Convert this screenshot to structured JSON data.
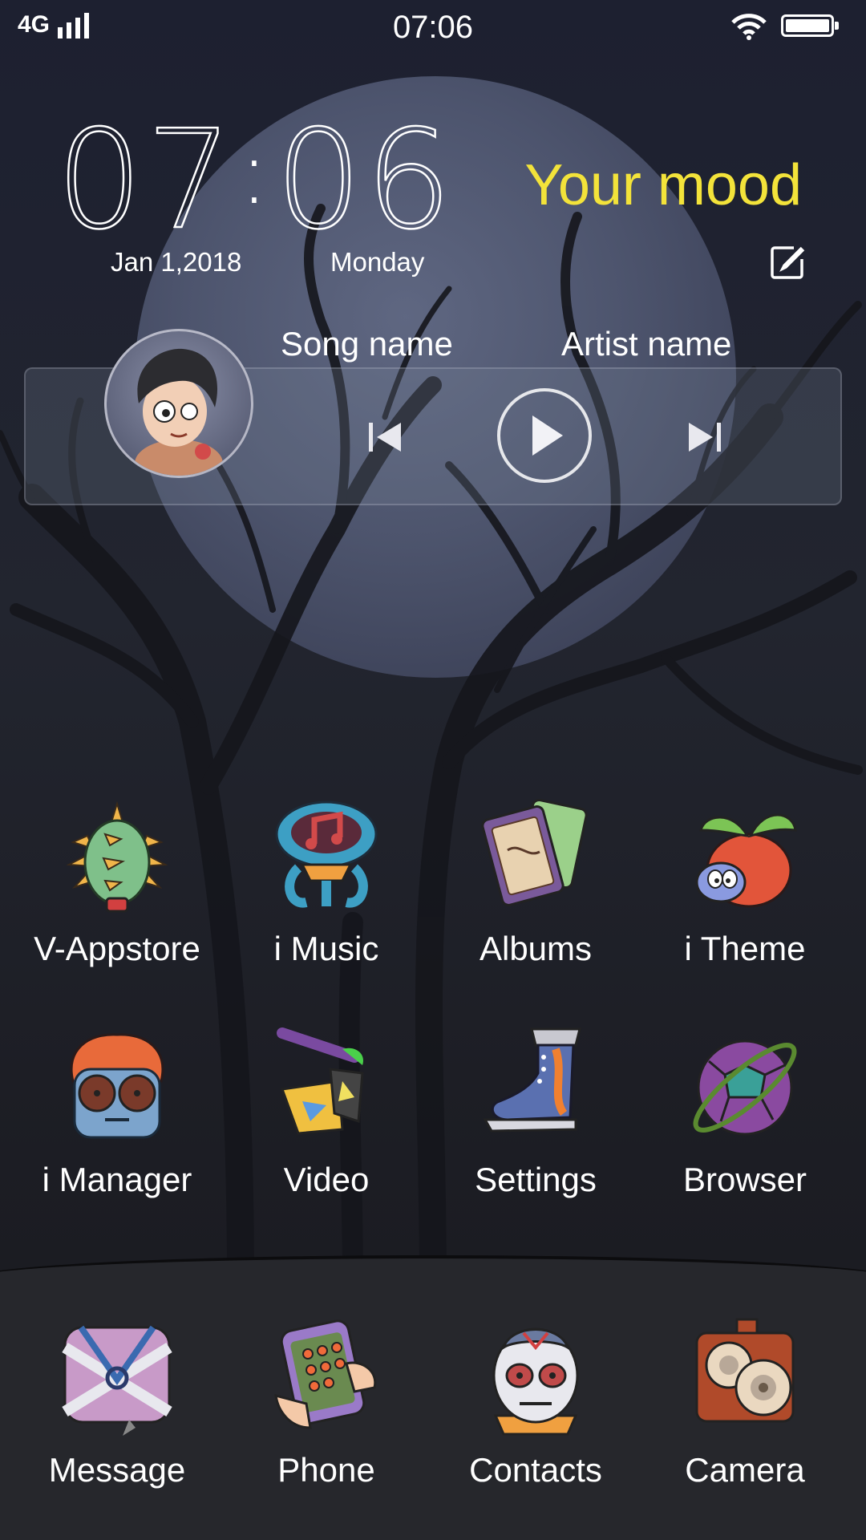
{
  "status_bar": {
    "network": "4G",
    "time": "07:06",
    "battery_level": 1.0
  },
  "clock_widget": {
    "hours": "07",
    "minutes": "06",
    "date": "Jan 1,2018",
    "weekday": "Monday",
    "mood": "Your mood"
  },
  "music_widget": {
    "song": "Song name",
    "artist": "Artist name"
  },
  "apps": {
    "row1": [
      {
        "label": "V-Appstore",
        "icon": "spiky-cactus-icon"
      },
      {
        "label": "i Music",
        "icon": "music-note-icon"
      },
      {
        "label": "Albums",
        "icon": "photo-cards-icon"
      },
      {
        "label": "i Theme",
        "icon": "tomato-creature-icon"
      }
    ],
    "row2": [
      {
        "label": "i Manager",
        "icon": "monster-face-icon"
      },
      {
        "label": "Video",
        "icon": "axe-icon"
      },
      {
        "label": "Settings",
        "icon": "boot-icon"
      },
      {
        "label": "Browser",
        "icon": "planet-ball-icon"
      }
    ],
    "dock": [
      {
        "label": "Message",
        "icon": "envelope-icon"
      },
      {
        "label": "Phone",
        "icon": "keypad-phone-icon"
      },
      {
        "label": "Contacts",
        "icon": "zombie-face-icon"
      },
      {
        "label": "Camera",
        "icon": "camera-icon"
      }
    ]
  },
  "colors": {
    "mood_text": "#f3e33a",
    "background": "#1d2030"
  }
}
